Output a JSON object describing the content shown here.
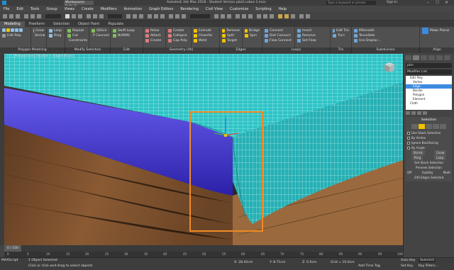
{
  "window": {
    "workspace": "Workspaces: Default",
    "title": "Autodesk 3ds Max 2018 - Student Version    plaid.cubes 2.max",
    "search_placeholder": "Type a keyword or phrase",
    "signin": "Sign In"
  },
  "menu": [
    "File",
    "Edit",
    "Tools",
    "Group",
    "Views",
    "Create",
    "Modifiers",
    "Animation",
    "Graph Editors",
    "Rendering",
    "Civil View",
    "Customize",
    "Scripting",
    "Help"
  ],
  "ribbon_tabs": [
    "Modeling",
    "Freeform",
    "Selection",
    "Object Paint",
    "Populate"
  ],
  "ribbon": {
    "col1": [
      "Edit Poly"
    ],
    "col2": [
      "Grow",
      "Shrink"
    ],
    "col3": [
      "Loop",
      "Ring"
    ],
    "col4": [
      "Repeat",
      "Cut",
      "Constraints"
    ],
    "col5": [
      "QSlice",
      "P Connect"
    ],
    "col6": [
      "Swift Loop",
      "NURMS"
    ],
    "col7": [
      "Relax",
      "Attach",
      "Create"
    ],
    "col8": [
      "Create",
      "Collapse",
      "Cap Poly"
    ],
    "col9": [
      "Extrude",
      "Chamfer",
      "Weld"
    ],
    "col10": [
      "Remove",
      "Split",
      "Target"
    ],
    "col11": [
      "Bridge",
      "Spin"
    ],
    "col12": [
      "Connect",
      "Dist Connect",
      "Flow Connect"
    ],
    "col13": [
      "Insert",
      "Remove",
      "Set Flow"
    ],
    "col14": [
      "Edit Tris",
      "Turn"
    ],
    "col15": [
      "MSmooth",
      "Tessellate",
      "Use Displac..."
    ],
    "col16": [
      "Make Planar"
    ]
  },
  "ribbon_footer": [
    "Polygon Modeling",
    "Modify Selection",
    "Edit",
    "Geometry (All)",
    "Edges",
    "Loops",
    "Tris",
    "Subdivision",
    "Align"
  ],
  "viewport": {
    "label": "[+] [Perspective] [Scaled + Edged Faces]",
    "colors": {
      "cloth": "#2ec4c4",
      "sheet": "#4a3fd6",
      "wood": "#8a5a33",
      "selection": "#f08a24"
    }
  },
  "command_panel": {
    "object_name": "plm",
    "modifier_list": "Modifier List",
    "stack": [
      {
        "label": "Edit Poly",
        "selected": false
      },
      {
        "label": "Vertex",
        "selected": false
      },
      {
        "label": "Edge",
        "selected": true
      },
      {
        "label": "Border",
        "selected": false
      },
      {
        "label": "Polygon",
        "selected": false
      },
      {
        "label": "Element",
        "selected": false
      },
      {
        "label": "Cloth",
        "selected": false
      }
    ],
    "selection_title": "Selection",
    "options": [
      "Use Stack Selection",
      "By Vertex",
      "Ignore Backfacing",
      "By Angle:"
    ],
    "shrink": "Shrink",
    "grow": "Grow",
    "ring": "Ring",
    "loop": "Loop",
    "get_stack": "Get Stack Selection",
    "preview": "Preview Selection",
    "preview_opts": [
      "Off",
      "SubObj",
      "Multi"
    ],
    "edges_selected": "240 Edges Selected"
  },
  "timeline": {
    "frame": "0 / 100",
    "ticks": [
      "0",
      "5",
      "10",
      "15",
      "20",
      "25",
      "30",
      "35",
      "40",
      "45",
      "50",
      "55",
      "60",
      "65",
      "70",
      "75",
      "80",
      "85",
      "90",
      "95",
      "100"
    ]
  },
  "status": {
    "selected": "1 Object Selected",
    "prompt": "Click or click-and-drag to select objects",
    "x": "X: 28.42cm",
    "y": "Y: 8.71cm",
    "z": "Z: 0.0cm",
    "grid": "Grid = 10.0cm",
    "autokey": "Auto Key",
    "autokey_val": "Selected",
    "setkey": "Set Key",
    "key_filters": "Key Filters...",
    "add_time_tag": "Add Time Tag"
  }
}
